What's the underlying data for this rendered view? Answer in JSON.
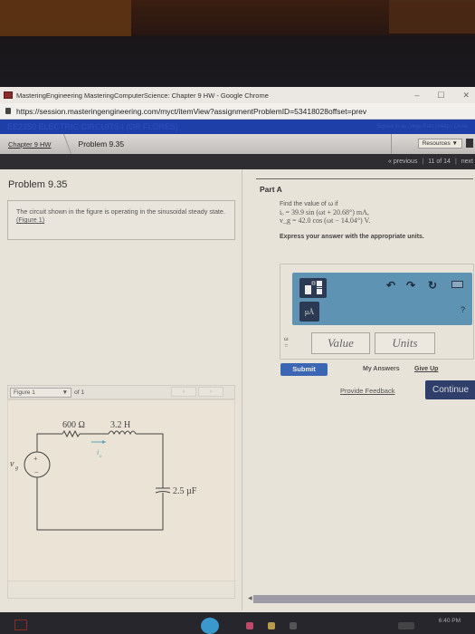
{
  "browser": {
    "window_title": "MasteringEngineering MasteringComputerScience: Chapter 9 HW - Google Chrome",
    "url": "https://session.masteringengineering.com/myct/itemView?assignmentProblemID=53418028offset=prev",
    "controls": {
      "minimize": "–",
      "maximize": "☐",
      "close": "✕"
    }
  },
  "course": {
    "name": "EE2350 ELECTRIC CIRCUITS I (DR FLORES)",
    "signed_in": "Signed in as Jorge Palo | Help | Close"
  },
  "breadcrumb": {
    "parent": "Chapter 9 HW",
    "current": "Problem 9.35",
    "resources_label": "Resources ▼"
  },
  "pager": {
    "previous": "« previous",
    "position": "11 of 14",
    "next": "next"
  },
  "problem": {
    "title": "Problem 9.35",
    "statement": "The circuit shown in the figure is operating in the sinusoidal steady state.",
    "figure_link": "(Figure 1)"
  },
  "figure_viewer": {
    "selected": "Figure 1",
    "of_label": "of 1",
    "prev": "‹",
    "next": "›"
  },
  "circuit": {
    "resistor": "600 Ω",
    "inductor": "3.2 H",
    "capacitor": "2.5 µF",
    "source": "v",
    "source_sub": "g",
    "current": "i",
    "current_sub": "o",
    "plus": "+",
    "minus": "−"
  },
  "part_a": {
    "label": "Part A",
    "prompt": "Find the value of ω if",
    "eq1": "iₒ = 39.9 sin (ωt + 20.68°) mA,",
    "eq2": "v_g = 42.0 cos (ωt − 14.04°) V.",
    "instruction": "Express your answer with the appropriate units."
  },
  "answer": {
    "variable_label": "ω\n=",
    "value_placeholder": "Value",
    "units_placeholder": "Units",
    "units_button": "µÅ",
    "help": "?",
    "toolbar_icons": [
      "fraction-template-icon",
      "undo-icon",
      "redo-icon",
      "reset-icon",
      "keyboard-icon"
    ]
  },
  "actions": {
    "submit": "Submit",
    "my_answers": "My Answers",
    "give_up": "Give Up",
    "feedback": "Provide Feedback",
    "continue": "Continue"
  },
  "taskbar": {
    "clock": "6:40 PM"
  },
  "colors": {
    "course_bar": "#1f3fa8",
    "toolbar": "#5f93b3",
    "submit": "#3b66b4",
    "continue": "#2f3e6a"
  }
}
